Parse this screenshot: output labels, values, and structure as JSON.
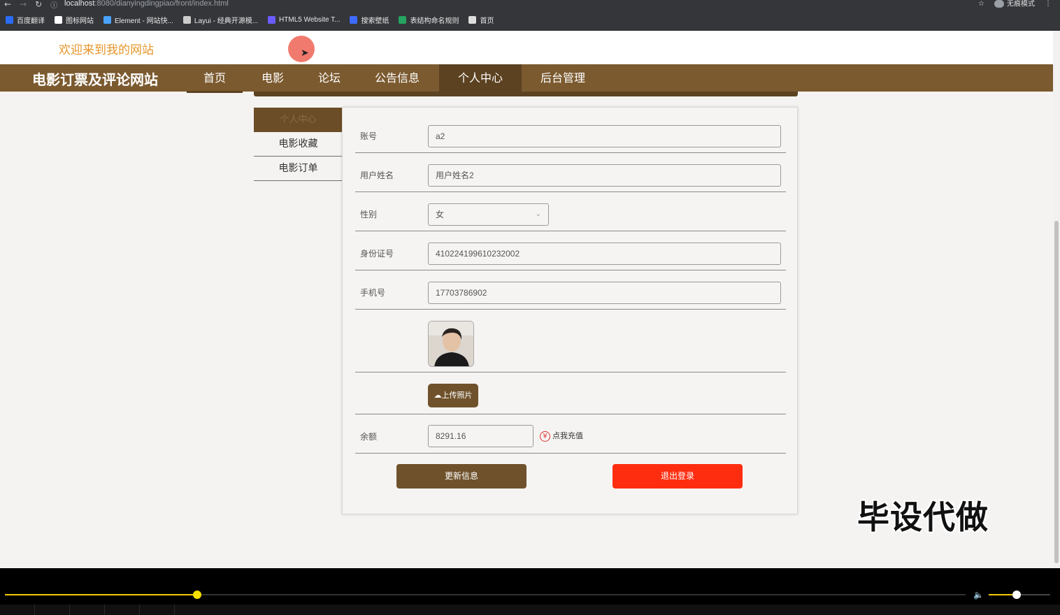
{
  "browser": {
    "url_host": "localhost",
    "url_path": ":8080/dianyingdingpiao/front/index.html",
    "profile_label": "无痕模式",
    "bookmarks": [
      {
        "label": "百度翻译",
        "color": "#2b6cf6"
      },
      {
        "label": "图标网站",
        "color": "#ffffff"
      },
      {
        "label": "Element - 网站快...",
        "color": "#4aa3ff"
      },
      {
        "label": "Layui - 经典开源模...",
        "color": "#cccccc"
      },
      {
        "label": "HTML5 Website T...",
        "color": "#6a5cff"
      },
      {
        "label": "搜索壁纸",
        "color": "#3d6bff"
      },
      {
        "label": "表结构命名规则",
        "color": "#25a55f"
      },
      {
        "label": "首页",
        "color": "#dddddd"
      }
    ]
  },
  "header": {
    "welcome": "欢迎来到我的网站",
    "site_title": "电影订票及评论网站",
    "nav": [
      {
        "label": "首页"
      },
      {
        "label": "电影"
      },
      {
        "label": "论坛"
      },
      {
        "label": "公告信息"
      },
      {
        "label": "个人中心",
        "active": true
      },
      {
        "label": "后台管理"
      }
    ]
  },
  "sidebar": {
    "items": [
      {
        "label": "个人中心",
        "active": true
      },
      {
        "label": "电影收藏"
      },
      {
        "label": "电影订单"
      }
    ]
  },
  "form": {
    "account_label": "账号",
    "account_value": "a2",
    "name_label": "用户姓名",
    "name_value": "用户姓名2",
    "gender_label": "性别",
    "gender_value": "女",
    "idcard_label": "身份证号",
    "idcard_value": "410224199610232002",
    "phone_label": "手机号",
    "phone_value": "17703786902",
    "upload_label": "上传照片",
    "balance_label": "余额",
    "balance_value": "8291.16",
    "recharge_label": "点我充值",
    "update_button": "更新信息",
    "logout_button": "退出登录"
  },
  "overlay": {
    "watermark": "毕设代做"
  },
  "player": {
    "progress": 0.2,
    "volume": 0.45
  },
  "colors": {
    "brand": "#7b5a2f",
    "brand_dark": "#5c4221",
    "welcome_text": "#e6962b",
    "logout": "#ff2d10",
    "progress": "#f5c800"
  }
}
